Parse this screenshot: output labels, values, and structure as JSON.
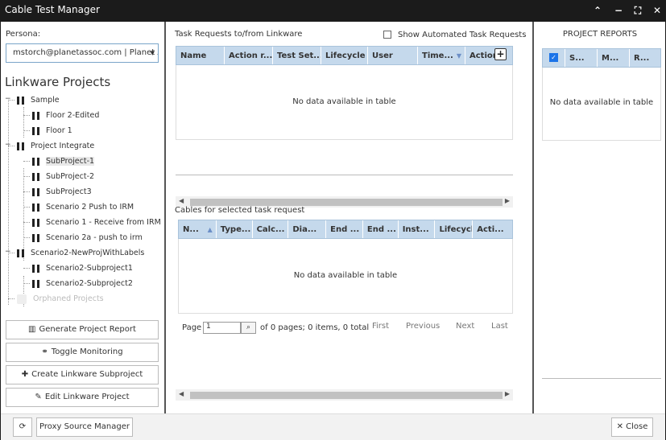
{
  "window": {
    "title": "Cable Test Manager"
  },
  "titlebar_buttons": {
    "collapse": "⌃",
    "minimize": "−",
    "maximize": "⛶",
    "close": "✕"
  },
  "left": {
    "persona_label": "Persona:",
    "persona_value": "mstorch@planetassoc.com | Planet A",
    "projects_title": "Linkware Projects",
    "tree": [
      {
        "label": "Sample",
        "level": 0,
        "toggle": "−"
      },
      {
        "label": "Floor 2-Edited",
        "level": 1
      },
      {
        "label": "Floor 1",
        "level": 1
      },
      {
        "label": "Project Integrate",
        "level": 0,
        "toggle": "−"
      },
      {
        "label": "SubProject-1",
        "level": 1,
        "selected": true
      },
      {
        "label": "SubProject-2",
        "level": 1
      },
      {
        "label": "SubProject3",
        "level": 1
      },
      {
        "label": "Scenario 2 Push to IRM",
        "level": 1
      },
      {
        "label": "Scenario 1 - Receive from IRM",
        "level": 1
      },
      {
        "label": "Scenario 2a - push to irm",
        "level": 1
      },
      {
        "label": "Scenario2-NewProjWithLabels",
        "level": 0,
        "toggle": "−"
      },
      {
        "label": "Scenario2-Subproject1",
        "level": 1
      },
      {
        "label": "Scenario2-Subproject2",
        "level": 1
      },
      {
        "label": "Orphaned Projects",
        "level": 0,
        "muted": true
      }
    ],
    "buttons": {
      "generate_report": "Generate Project Report",
      "toggle_monitoring": "Toggle Monitoring",
      "create_subproject": "Create Linkware Subproject",
      "edit_project": "Edit Linkware Project"
    }
  },
  "tasks": {
    "title": "Task Requests to/from Linkware",
    "show_automated_label": "Show Automated Task Requests",
    "columns": [
      "Name",
      "Action r...",
      "Test Set...",
      "Lifecycle St",
      "User",
      "Time...",
      "Action"
    ],
    "empty_text": "No data available in table"
  },
  "cables": {
    "title": "Cables for selected task request",
    "columns": [
      "N...",
      "Type...",
      "Calc...",
      "Dia...",
      "End ...",
      "End ...",
      "Inst...",
      "Lifecycle",
      "Acti..."
    ],
    "empty_text": "No data available in table",
    "pager": {
      "page_label": "Page",
      "page_value": "1",
      "summary": "of 0 pages; 0 items, 0 total",
      "first": "First",
      "previous": "Previous",
      "next": "Next",
      "last": "Last"
    }
  },
  "reports": {
    "title": "PROJECT REPORTS",
    "columns": [
      "S...",
      "M...",
      "R..."
    ],
    "empty_text": "No data available in table"
  },
  "footer": {
    "proxy_source_manager": "Proxy Source Manager",
    "close": "Close"
  },
  "colors": {
    "titlebar": "#1b1b1b",
    "grid_header": "#c5d9ec",
    "accent": "#1a73e8"
  }
}
